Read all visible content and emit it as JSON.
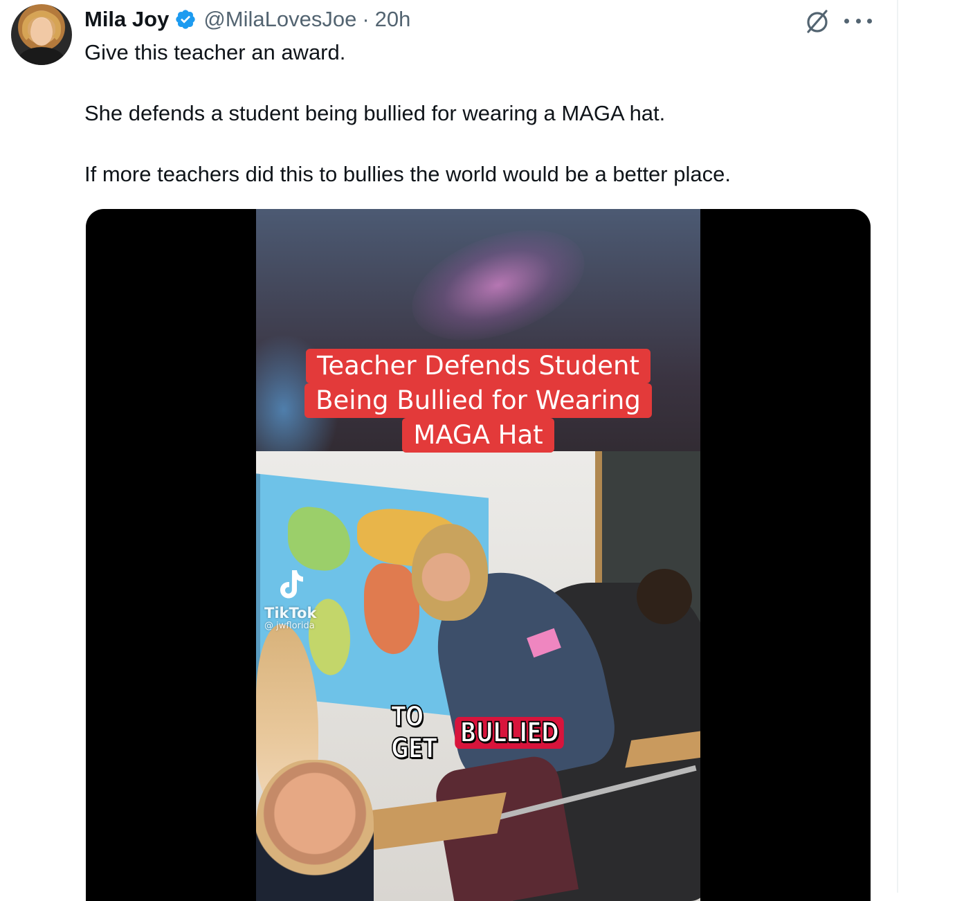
{
  "tweet": {
    "author": {
      "display_name": "Mila Joy",
      "handle": "@MilaLovesJoe",
      "separator": "·",
      "time": "20h",
      "verified": true
    },
    "text": {
      "p1": "Give this teacher an award.",
      "p2": "She defends a student being bullied for wearing a MAGA hat.",
      "p3": "If more teachers did this to bullies the world would be a better place."
    },
    "icons": {
      "grok": "grok-icon",
      "more": "more-options-icon",
      "verified": "verified-badge-icon"
    },
    "media": {
      "overlay_title": {
        "line1": "Teacher Defends Student",
        "line2": "Being Bullied for Wearing",
        "line3": "MAGA Hat"
      },
      "tiktok": {
        "brand": "TikTok",
        "user": "@ jwflorida"
      },
      "caption": {
        "word1": "TO GET",
        "word2": "BULLIED"
      }
    }
  },
  "colors": {
    "text_primary": "#0f1419",
    "text_secondary": "#536471",
    "verified_blue": "#1d9bf0",
    "overlay_red": "#e33a3a",
    "caption_red": "#d8143c"
  }
}
